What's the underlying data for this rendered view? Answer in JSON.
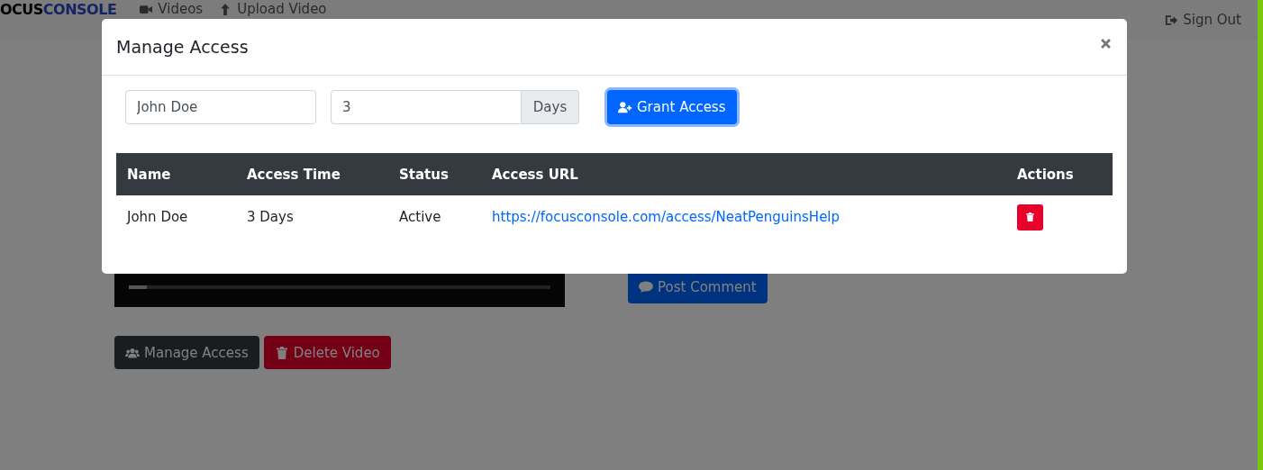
{
  "navbar": {
    "logo": {
      "part_1": "OCUS",
      "part_2": "CONSOLE"
    },
    "links": [
      "Videos",
      "Upload Video"
    ],
    "sign_out": "Sign Out"
  },
  "page": {
    "post_comment": "Post Comment",
    "buttons": [
      {
        "label": "Manage Access",
        "kind": "dark"
      },
      {
        "label": "Delete Video",
        "kind": "danger"
      }
    ]
  },
  "modal": {
    "title": "Manage Access",
    "name_field": {
      "value": "John Doe"
    },
    "days_field": {
      "value": "3",
      "addon": "Days"
    },
    "grant_button": "Grant Access",
    "table": {
      "columns": [
        "Name",
        "Access Time",
        "Status",
        "Access URL",
        "Actions"
      ],
      "rows": [
        {
          "name": "John Doe",
          "access_time": "3 Days",
          "status": "Active",
          "access_url": "https://focusconsole.com/access/NeatPenguinsHelp"
        }
      ]
    }
  }
}
